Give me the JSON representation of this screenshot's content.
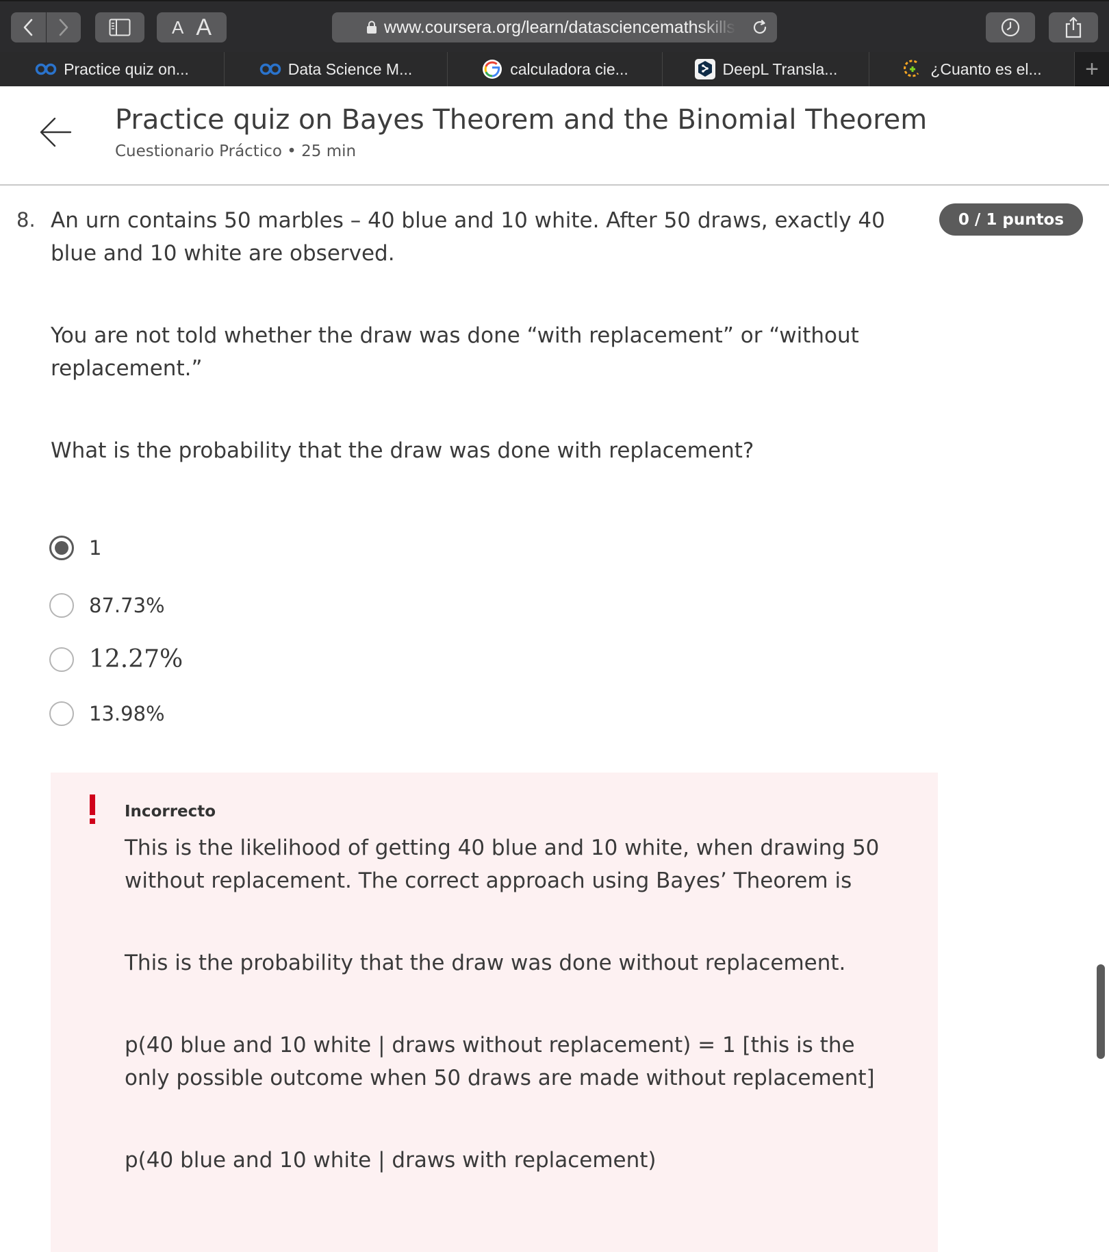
{
  "browser": {
    "url": "www.coursera.org/learn/datasciencemathskills",
    "font_small": "A",
    "font_large": "A",
    "tabs": [
      {
        "label": "Practice quiz on...",
        "icon": "coursera-icon"
      },
      {
        "label": "Data Science M...",
        "icon": "coursera-icon"
      },
      {
        "label": "calculadora cie...",
        "icon": "google-icon"
      },
      {
        "label": "DeepL Transla...",
        "icon": "deepl-icon"
      },
      {
        "label": "¿Cuanto es el...",
        "icon": "calculator-site-icon"
      }
    ],
    "new_tab": "+"
  },
  "header": {
    "title": "Practice quiz on Bayes Theorem and the Binomial Theorem",
    "subtitle": "Cuestionario Práctico • 25 min"
  },
  "question": {
    "number": "8.",
    "points": "0 / 1 puntos",
    "paragraphs": [
      "An urn contains 50 marbles – 40 blue and 10 white. After 50 draws, exactly 40 blue and 10 white are observed.",
      "You are not told whether the draw was done “with replacement” or “without replacement.”",
      "What is the probability that the draw was done with replacement?"
    ],
    "options": [
      {
        "label": "1",
        "selected": true
      },
      {
        "label": "87.73%",
        "selected": false
      },
      {
        "label": "12.27%",
        "selected": false
      },
      {
        "label": "13.98%",
        "selected": false
      }
    ]
  },
  "feedback": {
    "status": "Incorrecto",
    "accent_color": "#d0021b",
    "background_color": "#fdf1f2",
    "paragraphs": [
      "This is the likelihood of getting 40 blue and 10 white, when drawing 50 without replacement. The correct approach using Bayes’ Theorem is",
      "This is the probability that the draw was done without replacement.",
      "p(40 blue and 10 white | draws without replacement) = 1 [this is the only possible outcome when 50 draws are made without replacement]",
      "p(40 blue and 10 white | draws with replacement)"
    ]
  }
}
